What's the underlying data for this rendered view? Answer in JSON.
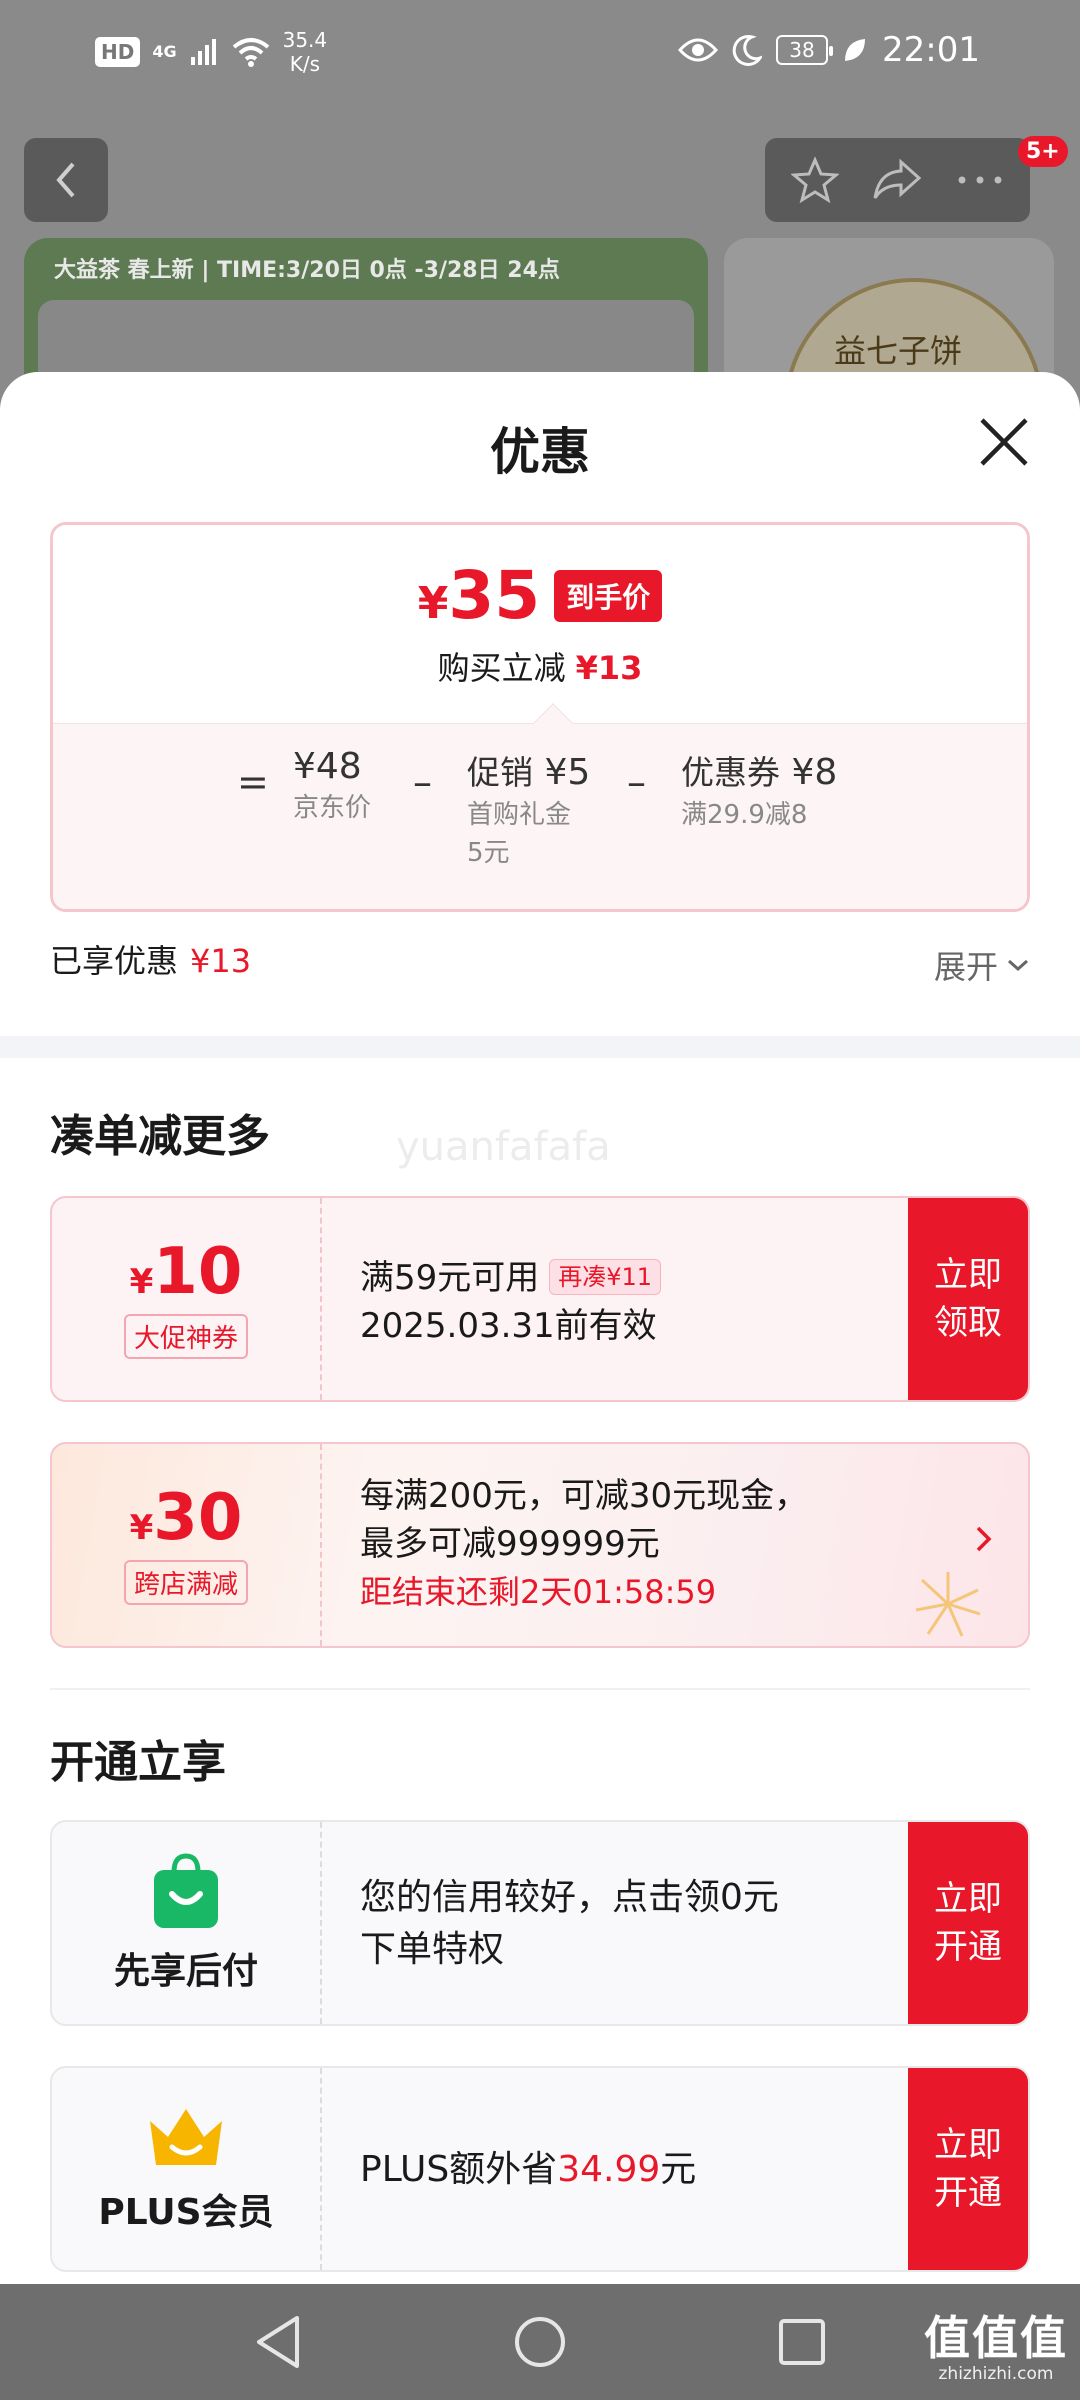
{
  "status_bar": {
    "hd": "HD",
    "network": "4G",
    "speed_value": "35.4",
    "speed_unit": "K/s",
    "battery": "38",
    "time": "22:01"
  },
  "background": {
    "badge": "5+",
    "banner_text": "大益茶 春上新 | TIME:3/20日 0点 -3/28日 24点",
    "product_text": "益七子饼"
  },
  "sheet": {
    "title": "优惠",
    "price_box": {
      "yen": "¥",
      "final_price": "35",
      "final_tag": "到手价",
      "instant_label": "购买立减",
      "instant_value": "¥13",
      "equals": "=",
      "minus": "–",
      "jd_price": "¥48",
      "jd_price_label": "京东价",
      "promo_label": "促销",
      "promo_value": "¥5",
      "promo_sub": [
        "首购礼金",
        "5元"
      ],
      "coupon_label": "优惠券",
      "coupon_value": "¥8",
      "coupon_sub": "满29.9减8"
    },
    "enjoyed_label": "已享优惠",
    "enjoyed_value": "¥13",
    "expand_label": "展开",
    "section_more": "凑单减更多",
    "watermark": "yuanfafafa",
    "coupon1": {
      "yen": "¥",
      "amount": "10",
      "tag": "大促神券",
      "condition": "满59元可用",
      "extra_tag": "再凑¥11",
      "validity": "2025.03.31前有效",
      "cta_line1": "立即",
      "cta_line2": "领取"
    },
    "coupon2": {
      "yen": "¥",
      "amount": "30",
      "tag": "跨店满减",
      "line1": "每满200元，可减30元现金，",
      "line2": "最多可减999999元",
      "countdown": "距结束还剩2天01:58:59"
    },
    "section_open": "开通立享",
    "pay_later": {
      "name": "先享后付",
      "desc_line1": "您的信用较好，点击领0元",
      "desc_line2": "下单特权",
      "cta_line1": "立即",
      "cta_line2": "开通"
    },
    "plus": {
      "name": "PLUS会员",
      "desc_prefix": "PLUS额外省",
      "desc_amount": "34.99",
      "desc_suffix": "元",
      "cta_line1": "立即",
      "cta_line2": "开通"
    }
  },
  "watermark_site": {
    "big": "值值值",
    "small": "zhizhizhi.com"
  },
  "colors": {
    "accent_red": "#e8182a",
    "pay_later_green": "#18b866",
    "plus_gold": "#f7b500"
  }
}
